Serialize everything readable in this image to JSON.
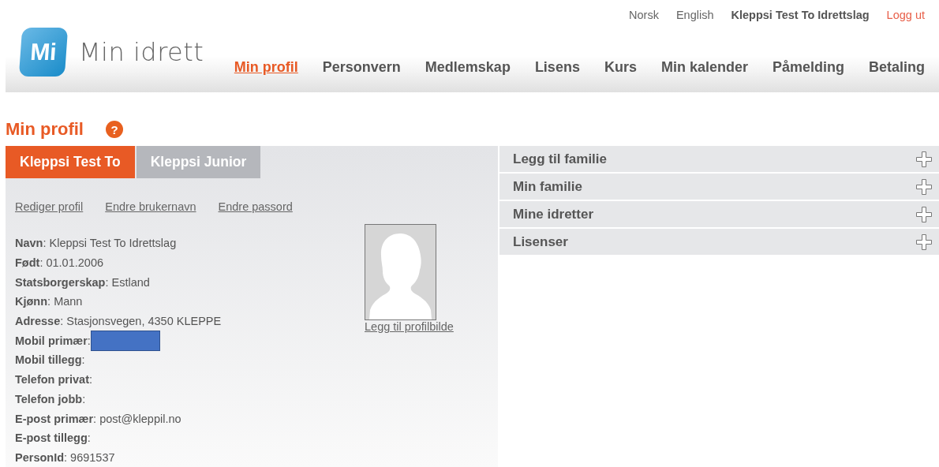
{
  "top_links": [
    {
      "label": "Norsk",
      "kind": "lang"
    },
    {
      "label": "English",
      "kind": "lang"
    },
    {
      "label": "Kleppsi Test To Idrettslag",
      "kind": "user"
    },
    {
      "label": "Logg ut",
      "kind": "logout"
    }
  ],
  "logo": {
    "mark": "Mi",
    "name": "Min idrett"
  },
  "nav": [
    {
      "label": "Min profil",
      "selected": true
    },
    {
      "label": "Personvern",
      "selected": false
    },
    {
      "label": "Medlemskap",
      "selected": false
    },
    {
      "label": "Lisens",
      "selected": false
    },
    {
      "label": "Kurs",
      "selected": false
    },
    {
      "label": "Min kalender",
      "selected": false
    },
    {
      "label": "Påmelding",
      "selected": false
    },
    {
      "label": "Betaling",
      "selected": false
    }
  ],
  "page_title": "Min profil",
  "help_icon": "?",
  "profile_tabs": [
    {
      "label": "Kleppsi Test To",
      "selected": true
    },
    {
      "label": "Kleppsi Junior",
      "selected": false
    }
  ],
  "profile_links": [
    "Rediger profil",
    "Endre brukernavn",
    "Endre passord"
  ],
  "fields": [
    {
      "text": "**Navn**: Kleppsi Test To Idrettslag"
    },
    {
      "text": "**Født**: 01.01.2006"
    },
    {
      "text": "**Statsborgerskap**: Estland"
    },
    {
      "text": "**Kjønn**: Mann"
    },
    {
      "text": "**Adresse**: Stasjonsvegen, 4350 KLEPPE"
    },
    {
      "text": "**Mobil primær**:",
      "redacted": true
    },
    {
      "text": "**Mobil tillegg**:"
    },
    {
      "text": "**Telefon privat**:"
    },
    {
      "text": "**Telefon jobb**:"
    },
    {
      "text": "**E-post primær**: post@kleppil.no"
    },
    {
      "text": "**E-post tillegg**:"
    },
    {
      "text": "**PersonId**: 9691537"
    }
  ],
  "photo_link": "Legg til profilbilde",
  "accordion": [
    {
      "label": "Legg til familie",
      "expanded": false
    },
    {
      "label": "Min familie",
      "expanded": false
    },
    {
      "label": "Mine idretter",
      "expanded": false
    },
    {
      "label": "Lisenser",
      "expanded": false
    }
  ]
}
